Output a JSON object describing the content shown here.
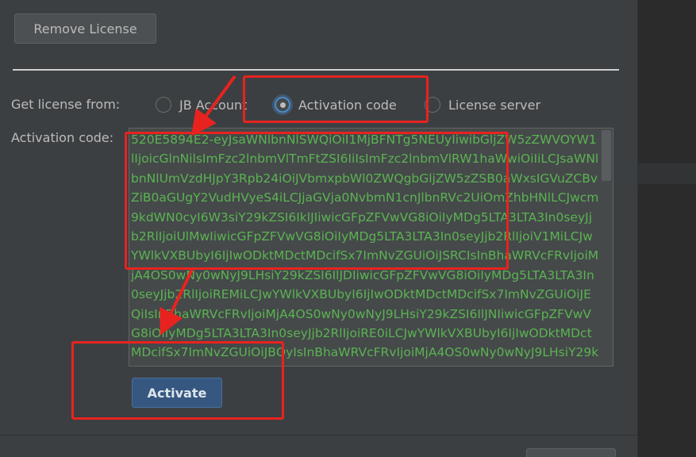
{
  "buttons": {
    "remove_license": "Remove License",
    "activate": "Activate"
  },
  "license_source": {
    "label": "Get license from:",
    "options": [
      {
        "label": "JB Account",
        "selected": false
      },
      {
        "label": "Activation code",
        "selected": true
      },
      {
        "label": "License server",
        "selected": false
      }
    ]
  },
  "activation": {
    "label": "Activation code:",
    "code_value": "520E5894E2-eyJsaWNlbnNlSWQiOiI1MjBFNTg5NEUyIiwibGljZW5zZWVOYW1lIjoicGlnNilsImFzc2lnbmVlTmFtZSI6IiIsImFzc2lnbmVlRW1haWwiOiIiLCJsaWNlbnNlUmVzdHJpY3Rpb24iOiJVbmxpbWl0ZWQgbGljZW5zZSB0aWxsIGVuZCBvZiB0aGUgY2VudHVyeS4iLCJjaGVja0NvbmN1cnJlbnRVc2UiOmZhbHNlLCJwcm9kdWN0cyI6W3siY29kZSI6IklJIiwicGFpZFVwVG8iOiIyMDg5LTA3LTA3In0seyJjb2RlIjoiUlMwIiwicGFpZFVwVG8iOiIyMDg5LTA3LTA3In0seyJjb2RlIjoiV1MiLCJwYWlkVXBUbyI6IjIwODktMDctMDcifSx7ImNvZGUiOiJSRCIsInBhaWRVcFRvIjoiMjA4OS0wNy0wNyJ9LHsiY29kZSI6IlJDIiwicGFpZFVwVG8iOiIyMDg5LTA3LTA3In0seyJjb2RlIjoiREMiLCJwYWlkVXBUbyI6IjIwODktMDctMDcifSx7ImNvZGUiOiJEQiIsInBhaWRVcFRvIjoiMjA4OS0wNy0wNyJ9LHsiY29kZSI6IlJNIiwicGFpZFVwVG8iOiIyMDg5LTA3LTA3In0seyJjb2RlIjoiRE0iLCJwYWlkVXBUbyI6IjIwODktMDctMDcifSx7ImNvZGUiOiJBQyIsInBhaWRVcFRvIjoiMjA4OS0wNy0wNyJ9LHsiY29k"
  },
  "colors": {
    "background": "#3c3f41",
    "code_text": "#5bb352",
    "accent": "#4a88c7",
    "annotation": "#e8231f",
    "primary_button": "#365880"
  }
}
